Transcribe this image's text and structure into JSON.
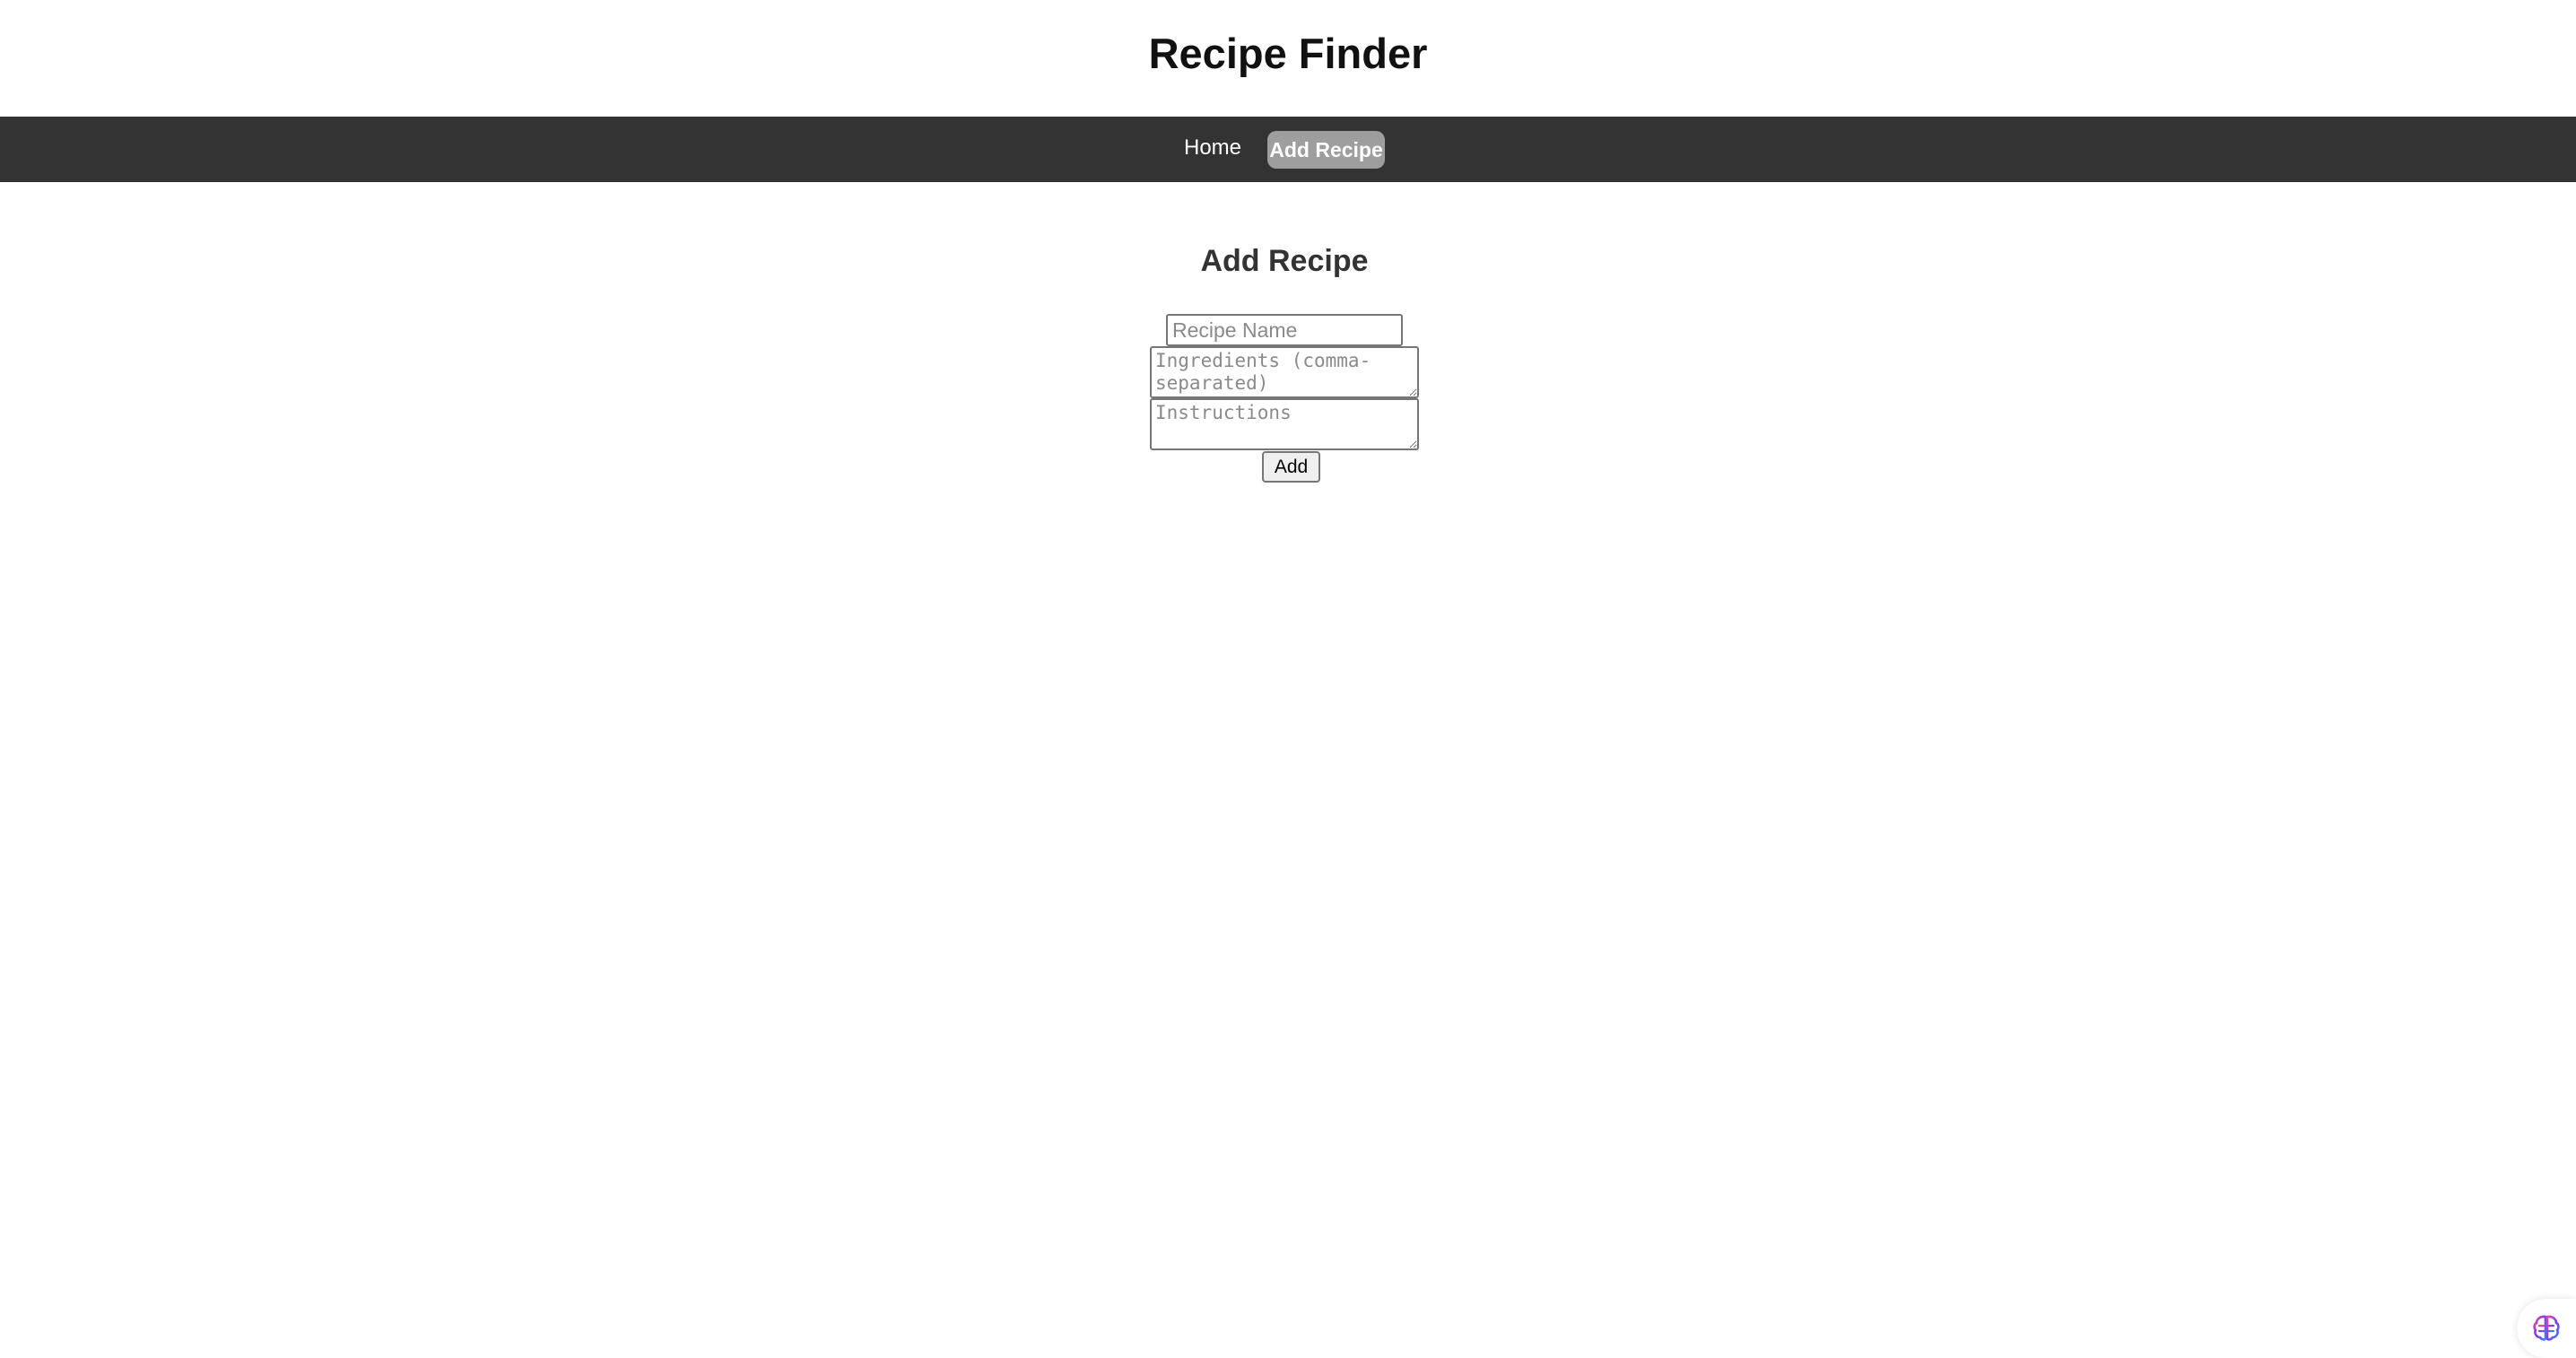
{
  "header": {
    "title": "Recipe Finder"
  },
  "nav": {
    "items": [
      {
        "label": "Home",
        "active": false
      },
      {
        "label": "Add Recipe",
        "active": true
      }
    ],
    "background_color": "#333333",
    "active_color": "#9e9e9e"
  },
  "form": {
    "title": "Add Recipe",
    "recipe_name": {
      "value": "",
      "placeholder": "Recipe Name"
    },
    "ingredients": {
      "value": "",
      "placeholder": "Ingredients (comma-separated)"
    },
    "instructions": {
      "value": "",
      "placeholder": "Instructions"
    },
    "submit_label": "Add"
  },
  "assistant_widget": {
    "icon": "brain-icon",
    "colors": [
      "#7c3aed",
      "#ec4899",
      "#3b82f6"
    ]
  }
}
